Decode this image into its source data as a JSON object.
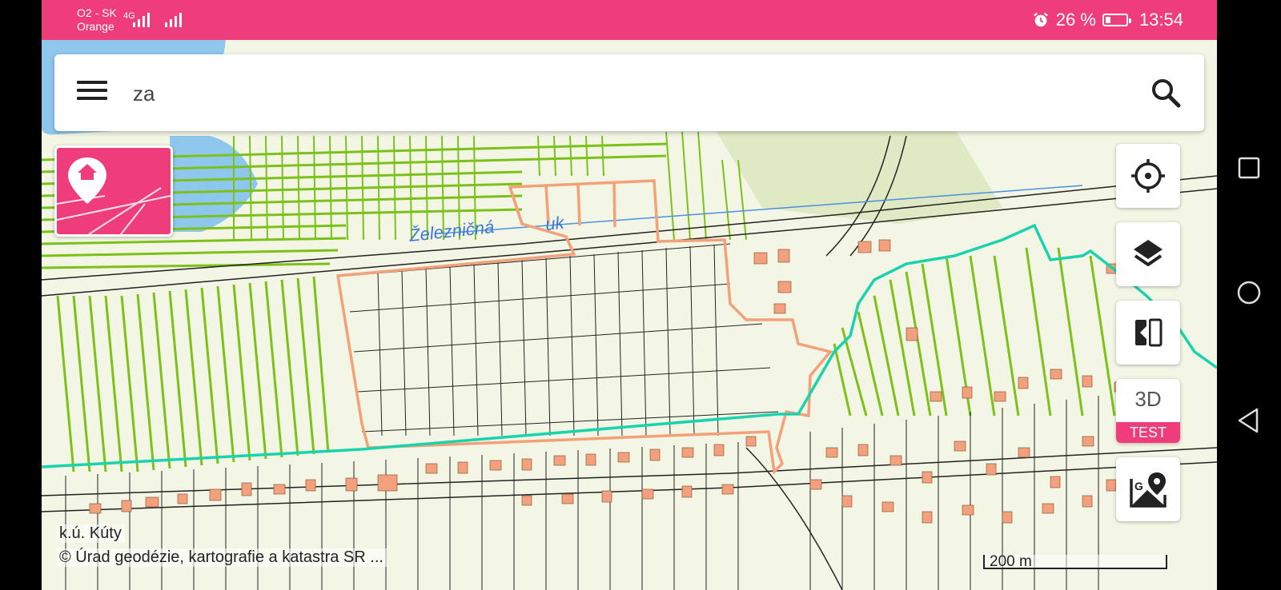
{
  "status_bar": {
    "carrier_line1": "O2 - SK",
    "carrier_line2": "Orange",
    "network": "4G",
    "battery_text": "26 %",
    "battery_level": 0.26,
    "time": "13:54",
    "icons": [
      "alarm-icon",
      "battery-icon"
    ]
  },
  "search": {
    "value": "za",
    "icons": [
      "menu-icon",
      "search-icon"
    ]
  },
  "map": {
    "street_label": "Železničná",
    "street_label_tail": "uk",
    "cadastral_area": "k.ú. Kúty",
    "attribution": "© Úrad geodézie, kartografie a katastra SR ...",
    "scale_label": "200 m"
  },
  "controls": {
    "locate_icon": "crosshair-icon",
    "layers_icon": "layers-icon",
    "compare_icon": "split-compare-icon",
    "three_d_label": "3D",
    "three_d_badge": "TEST",
    "google_maps_icon": "google-maps-icon",
    "cadastre_icon": "home-pin-icon"
  },
  "colors": {
    "accent": "#ee3d7a",
    "boundary": "#19d3ae",
    "parcel_highlight": "#f2a17a",
    "vegetation": "#7cc11a",
    "building": "#f3a07d"
  },
  "system_nav": {
    "icons": [
      "recents-icon",
      "home-icon",
      "back-icon"
    ]
  }
}
